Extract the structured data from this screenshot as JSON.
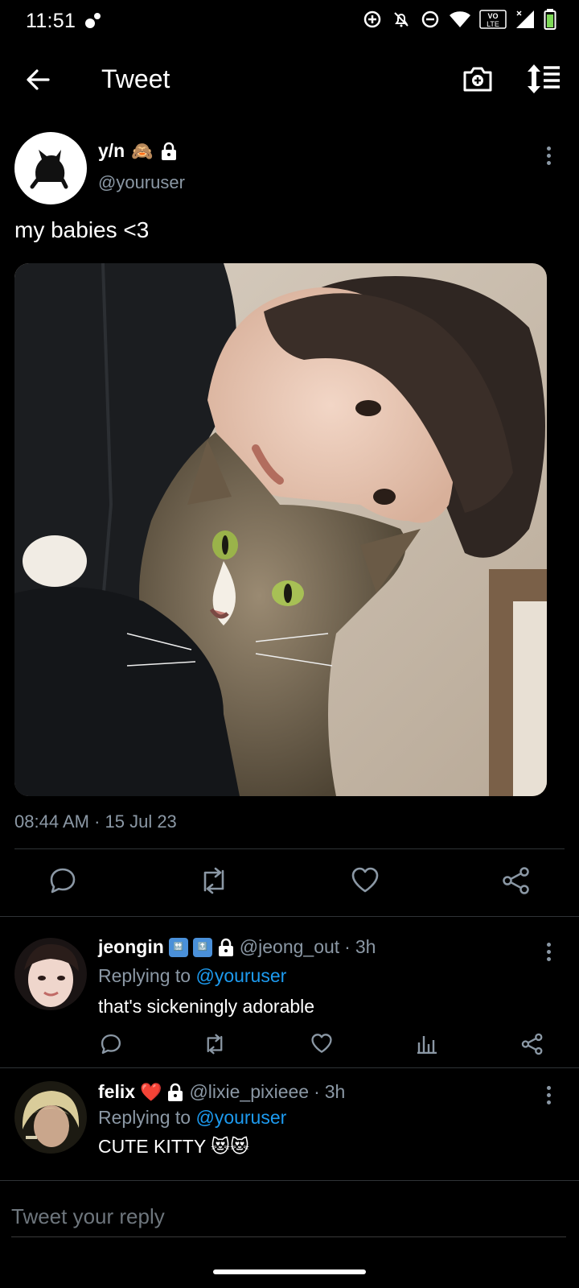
{
  "status_bar": {
    "time": "11:51",
    "network_label": "VO LTE"
  },
  "header": {
    "title": "Tweet"
  },
  "tweet": {
    "author_name": "y/n",
    "author_emoji": "🙈",
    "handle": "@youruser",
    "text": "my babies <3",
    "timestamp": "08:44 AM · 15 Jul 23"
  },
  "replies": [
    {
      "name": "jeongin",
      "badges": [
        "🔛",
        "🔝"
      ],
      "handle": "@jeong_out",
      "time": "3h",
      "replying_label": "Replying to",
      "replying_to": "@youruser",
      "text": "that's sickeningly adorable"
    },
    {
      "name": "felix",
      "badges": [
        "❤️"
      ],
      "handle": "@lixie_pixieee",
      "time": "3h",
      "replying_label": "Replying to",
      "replying_to": "@youruser",
      "text": "CUTE KITTY 😻😻"
    }
  ],
  "composer": {
    "placeholder": "Tweet your reply"
  },
  "colors": {
    "background": "#000000",
    "muted": "#8b98a5",
    "link": "#1d9bf0",
    "divider": "#2f3336"
  }
}
